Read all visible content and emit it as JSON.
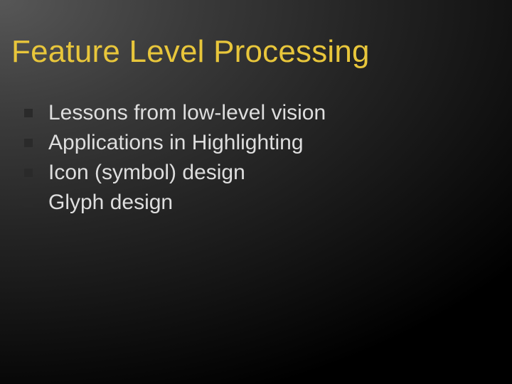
{
  "title": "Feature Level Processing",
  "bullets": [
    "Lessons from low-level vision",
    "Applications in Highlighting",
    "Icon (symbol)  design",
    "Glyph design"
  ]
}
